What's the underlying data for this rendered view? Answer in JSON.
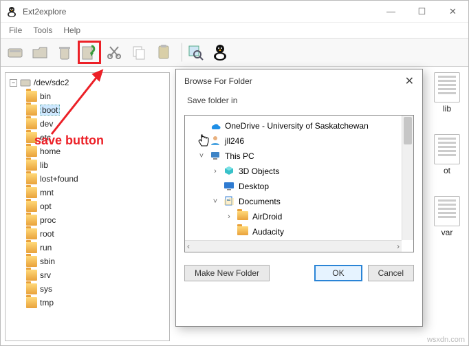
{
  "window": {
    "title": "Ext2explore",
    "buttons": {
      "min": "—",
      "max": "☐",
      "close": "✕"
    }
  },
  "menubar": {
    "file": "File",
    "tools": "Tools",
    "help": "Help"
  },
  "toolbar": {
    "rescan": "rescan",
    "open": "open",
    "delete": "delete",
    "save": "save",
    "cut": "cut",
    "copy": "copy",
    "paste": "paste",
    "search": "search",
    "about": "about"
  },
  "tree": {
    "root": "/dev/sdc2",
    "items": [
      "bin",
      "boot",
      "dev",
      "etc",
      "home",
      "lib",
      "lost+found",
      "mnt",
      "opt",
      "proc",
      "root",
      "run",
      "sbin",
      "srv",
      "sys",
      "tmp"
    ],
    "selected": "boot"
  },
  "right_icons": [
    {
      "name": "lib"
    },
    {
      "name": "ot"
    },
    {
      "name": "var"
    }
  ],
  "annotation": {
    "label": "save button"
  },
  "dialog": {
    "title": "Browse For Folder",
    "message": "Save folder in",
    "close": "✕",
    "items": [
      {
        "depth": 0,
        "exp": "",
        "icon": "onedrive",
        "label": "OneDrive - University of Saskatchewan"
      },
      {
        "depth": 0,
        "exp": "",
        "icon": "user",
        "label": "jll246",
        "cursor": true
      },
      {
        "depth": 0,
        "exp": "v",
        "icon": "pc",
        "label": "This PC"
      },
      {
        "depth": 1,
        "exp": ">",
        "icon": "obj3d",
        "label": "3D Objects"
      },
      {
        "depth": 1,
        "exp": "",
        "icon": "desktop",
        "label": "Desktop"
      },
      {
        "depth": 1,
        "exp": "v",
        "icon": "docs",
        "label": "Documents"
      },
      {
        "depth": 2,
        "exp": ">",
        "icon": "folder",
        "label": "AirDroid"
      },
      {
        "depth": 2,
        "exp": "",
        "icon": "folder",
        "label": "Audacity"
      }
    ],
    "buttons": {
      "new": "Make New Folder",
      "ok": "OK",
      "cancel": "Cancel"
    }
  },
  "watermark": "wsxdn.com"
}
